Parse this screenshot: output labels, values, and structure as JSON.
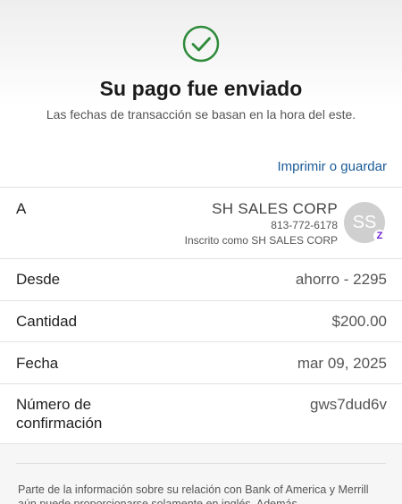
{
  "header": {
    "title": "Su pago fue enviado",
    "subtitle": "Las fechas de transacción se basan en la hora del este.",
    "success_color": "#2e8b3a",
    "icon": "check-circle-icon"
  },
  "actions": {
    "print_label": "Imprimir o guardar"
  },
  "details": {
    "to": {
      "label": "A",
      "name": "SH SALES CORP",
      "phone": "813-772-6178",
      "enrolled": "Inscrito como SH SALES CORP",
      "avatar_initials": "SS",
      "badge": "Z"
    },
    "from": {
      "label": "Desde",
      "value": "ahorro - 2295"
    },
    "amount": {
      "label": "Cantidad",
      "value": "$200.00"
    },
    "date": {
      "label": "Fecha",
      "value": "mar 09, 2025"
    },
    "confirmation": {
      "label_line1": "Número de",
      "label_line2": "confirmación",
      "value": "gws7dud6v"
    }
  },
  "footer": {
    "text": "Parte de la información sobre su relación con Bank of America y Merrill aún puede proporcionarse solamente en inglés. Además"
  }
}
